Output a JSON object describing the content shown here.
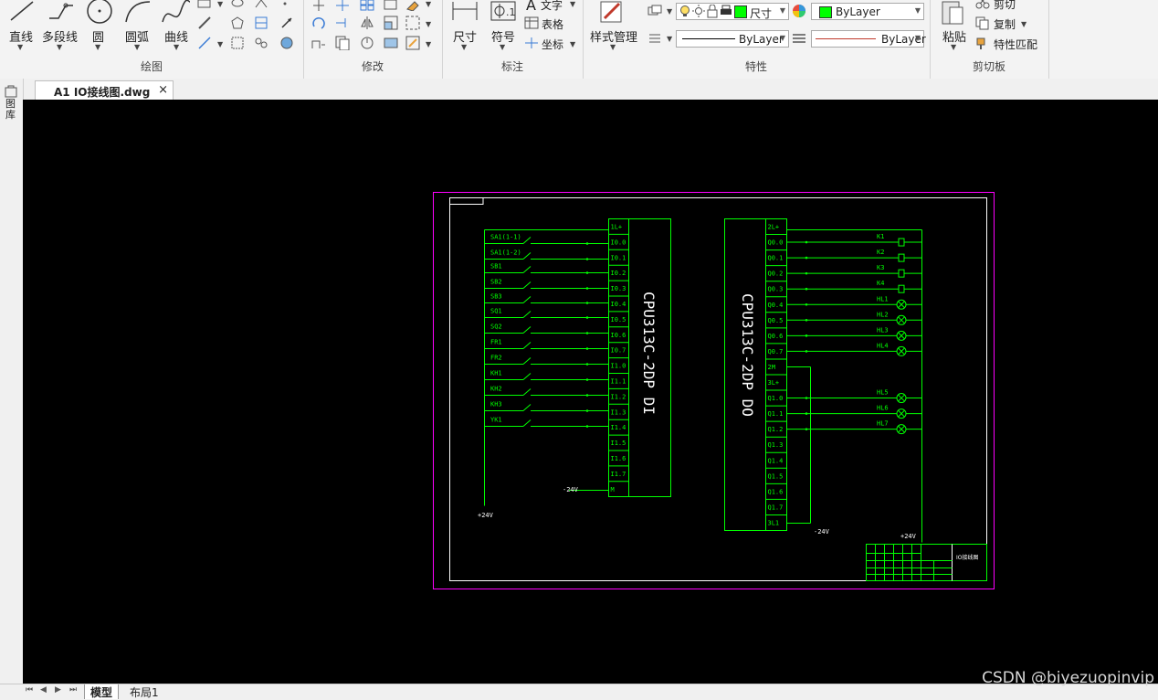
{
  "ribbon": {
    "draw_panel": {
      "label": "绘图",
      "tools": [
        "直线",
        "多段线",
        "圆",
        "圆弧",
        "曲线"
      ]
    },
    "modify_panel": {
      "label": "修改"
    },
    "annotate_panel": {
      "label": "标注",
      "dimension": "尺寸",
      "symbol": "符号",
      "text": "文字",
      "table": "表格",
      "coordinate": "坐标"
    },
    "properties_panel": {
      "label": "特性",
      "style_manager": "样式管理",
      "layer_name": "尺寸",
      "color_value": "ByLayer",
      "linetype_value": "ByLayer",
      "lineweight_value": "ByLayer"
    },
    "clipboard_panel": {
      "label": "剪切板",
      "paste": "粘贴",
      "cut": "剪切",
      "copy": "复制",
      "match_props": "特性匹配"
    }
  },
  "document_tab": {
    "title": "A1  IO接线图.dwg",
    "close": "×"
  },
  "left_strip": {
    "label": "图库"
  },
  "layout_tabs": [
    "模型",
    "布局1"
  ],
  "watermark": "CSDN @biyezuopinvip",
  "drawing": {
    "plc_di_title": "CPU313C-2DP  DI",
    "plc_do_title": "CPU313C-2DP  DO",
    "di_terminals": [
      "1L+",
      "I0.0",
      "I0.1",
      "I0.2",
      "I0.3",
      "I0.4",
      "I0.5",
      "I0.6",
      "I0.7",
      "I1.0",
      "I1.1",
      "I1.2",
      "I1.3",
      "I1.4",
      "I1.5",
      "I1.6",
      "I1.7",
      "M"
    ],
    "di_devices": [
      "SA1(1-1)",
      "SA1(1-2)",
      "SB1",
      "SB2",
      "SB3",
      "SQ1",
      "SQ2",
      "FR1",
      "FR2",
      "KH1",
      "KH2",
      "KH3",
      "YK1"
    ],
    "do_terminals": [
      "2L+",
      "Q0.0",
      "Q0.1",
      "Q0.2",
      "Q0.3",
      "Q0.4",
      "Q0.5",
      "Q0.6",
      "Q0.7",
      "2M",
      "3L+",
      "Q1.0",
      "Q1.1",
      "Q1.2",
      "Q1.3",
      "Q1.4",
      "Q1.5",
      "Q1.6",
      "Q1.7",
      "3L1"
    ],
    "do_devices": [
      "K1",
      "K2",
      "K3",
      "K4",
      "HL1",
      "HL2",
      "HL3",
      "HL4",
      "HL5",
      "HL6",
      "HL7"
    ],
    "supply_di_plus": "+24V",
    "supply_di_minus": "-24V",
    "supply_do_minus": "-24V",
    "supply_do_plus": "+24V",
    "title_block_text": "IO接线图",
    "colors": {
      "wire": "#00ff00",
      "frame": "#ffffff",
      "sheet": "#ff00ff",
      "canvas": "#000000"
    }
  }
}
